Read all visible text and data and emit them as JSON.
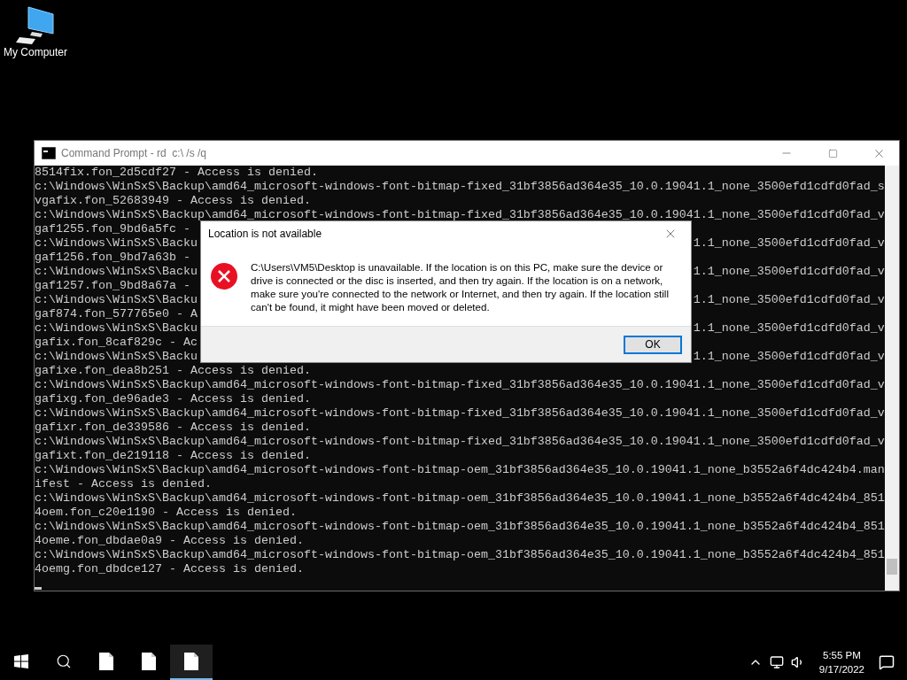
{
  "desktop_icons": [
    {
      "label": "My Computer"
    }
  ],
  "console_window": {
    "title": "Command Prompt - rd  c:\\ /s /q",
    "lines": [
      {
        "kind": "full",
        "text": "8514fix.fon_2d5cdf27 - Access is denied."
      },
      {
        "kind": "full",
        "text": "c:\\Windows\\WinSxS\\Backup\\amd64_microsoft-windows-font-bitmap-fixed_31bf3856ad364e35_10.0.19041.1_none_3500efd1cdfd0fad_s"
      },
      {
        "kind": "full",
        "text": "vgafix.fon_52683949 - Access is denied."
      },
      {
        "kind": "full",
        "text": "c:\\Windows\\WinSxS\\Backup\\amd64_microsoft-windows-font-bitmap-fixed_31bf3856ad364e35_10.0.19041.1_none_3500efd1cdfd0fad_v"
      },
      {
        "kind": "split",
        "text": "gaf1255.fon_9bd6a5fc -"
      },
      {
        "kind": "split",
        "text": "c:\\Windows\\WinSxS\\Backu",
        "right": "1.1_none_3500efd1cdfd0fad_v"
      },
      {
        "kind": "split",
        "text": "gaf1256.fon_9bd7a63b -"
      },
      {
        "kind": "split",
        "text": "c:\\Windows\\WinSxS\\Backu",
        "right": "1.1_none_3500efd1cdfd0fad_v"
      },
      {
        "kind": "split",
        "text": "gaf1257.fon_9bd8a67a -"
      },
      {
        "kind": "split",
        "text": "c:\\Windows\\WinSxS\\Backu",
        "right": "1.1_none_3500efd1cdfd0fad_v"
      },
      {
        "kind": "split",
        "text": "gaf874.fon_577765e0 - A"
      },
      {
        "kind": "split",
        "text": "c:\\Windows\\WinSxS\\Backu",
        "right": "1.1_none_3500efd1cdfd0fad_v"
      },
      {
        "kind": "split",
        "text": "gafix.fon_8caf829c - Ac"
      },
      {
        "kind": "split",
        "text": "c:\\Windows\\WinSxS\\Backu",
        "right": "1.1_none_3500efd1cdfd0fad_v"
      },
      {
        "kind": "full",
        "text": "gafixe.fon_dea8b251 - Access is denied."
      },
      {
        "kind": "full",
        "text": "c:\\Windows\\WinSxS\\Backup\\amd64_microsoft-windows-font-bitmap-fixed_31bf3856ad364e35_10.0.19041.1_none_3500efd1cdfd0fad_v"
      },
      {
        "kind": "full",
        "text": "gafixg.fon_de96ade3 - Access is denied."
      },
      {
        "kind": "full",
        "text": "c:\\Windows\\WinSxS\\Backup\\amd64_microsoft-windows-font-bitmap-fixed_31bf3856ad364e35_10.0.19041.1_none_3500efd1cdfd0fad_v"
      },
      {
        "kind": "full",
        "text": "gafixr.fon_de339586 - Access is denied."
      },
      {
        "kind": "full",
        "text": "c:\\Windows\\WinSxS\\Backup\\amd64_microsoft-windows-font-bitmap-fixed_31bf3856ad364e35_10.0.19041.1_none_3500efd1cdfd0fad_v"
      },
      {
        "kind": "full",
        "text": "gafixt.fon_de219118 - Access is denied."
      },
      {
        "kind": "full",
        "text": "c:\\Windows\\WinSxS\\Backup\\amd64_microsoft-windows-font-bitmap-oem_31bf3856ad364e35_10.0.19041.1_none_b3552a6f4dc424b4.man"
      },
      {
        "kind": "full",
        "text": "ifest - Access is denied."
      },
      {
        "kind": "full",
        "text": "c:\\Windows\\WinSxS\\Backup\\amd64_microsoft-windows-font-bitmap-oem_31bf3856ad364e35_10.0.19041.1_none_b3552a6f4dc424b4_851"
      },
      {
        "kind": "full",
        "text": "4oem.fon_c20e1190 - Access is denied."
      },
      {
        "kind": "full",
        "text": "c:\\Windows\\WinSxS\\Backup\\amd64_microsoft-windows-font-bitmap-oem_31bf3856ad364e35_10.0.19041.1_none_b3552a6f4dc424b4_851"
      },
      {
        "kind": "full",
        "text": "4oeme.fon_dbdae0a9 - Access is denied."
      },
      {
        "kind": "full",
        "text": "c:\\Windows\\WinSxS\\Backup\\amd64_microsoft-windows-font-bitmap-oem_31bf3856ad364e35_10.0.19041.1_none_b3552a6f4dc424b4_851"
      },
      {
        "kind": "full",
        "text": "4oemg.fon_dbdce127 - Access is denied."
      },
      {
        "kind": "cursor"
      }
    ]
  },
  "dialog": {
    "title": "Location is not available",
    "message": "C:\\Users\\VM5\\Desktop is unavailable. If the location is on this PC, make sure the device or drive is connected or the disc is inserted, and then try again. If the location is on a network, make sure you're connected to the network or Internet, and then try again. If the location still can't be found, it might have been moved or deleted.",
    "button": "OK"
  },
  "taskbar": {
    "apps": [
      {
        "selected": false
      },
      {
        "selected": false
      },
      {
        "selected": true
      }
    ],
    "time": "5:55 PM",
    "date": "9/17/2022"
  }
}
